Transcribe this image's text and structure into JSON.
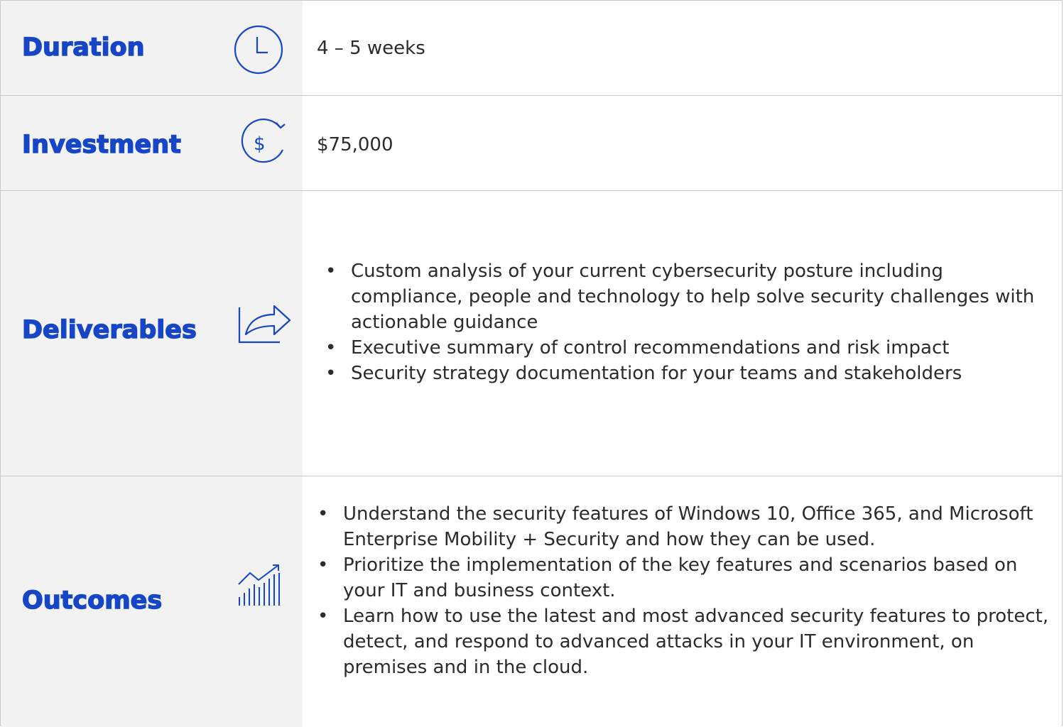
{
  "rows": {
    "duration": {
      "label": "Duration",
      "icon": "clock-icon",
      "value": "4 – 5 weeks"
    },
    "investment": {
      "label": "Investment",
      "icon": "dollar-refresh-icon",
      "value": "$75,000"
    },
    "deliverables": {
      "label": "Deliverables",
      "icon": "share-arrow-icon",
      "items": [
        "Custom analysis of your current cybersecurity posture including compliance, people and technology to help solve security challenges with actionable guidance",
        "Executive summary of control recommendations and risk impact",
        "Security strategy documentation for your teams and stakeholders"
      ]
    },
    "outcomes": {
      "label": "Outcomes",
      "icon": "growth-chart-icon",
      "items": [
        "Understand the security features of Windows 10, Office 365, and Microsoft Enterprise Mobility + Security and how they can be used.",
        "Prioritize the implementation of the key features and scenarios based on your IT and business context.",
        "Learn how to use the latest and most advanced security features to protect, detect, and respond to advanced attacks in your IT environment, on premises and in the cloud."
      ]
    }
  },
  "bullet_glyph": "•",
  "colors": {
    "accent": "#1646c6",
    "label_bg": "#f2f2f2",
    "text": "#2b2b2b",
    "border": "#c8c8c8"
  }
}
